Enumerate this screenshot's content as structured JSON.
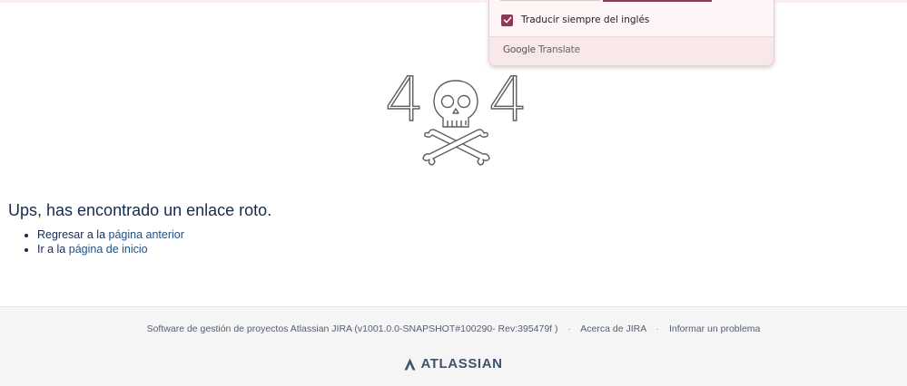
{
  "translate_popup": {
    "always_translate_label": "Traducir siempre del inglés",
    "always_translate_checked": true,
    "brand_google": "Google",
    "brand_translate": "Translate"
  },
  "error_page": {
    "digit_left": "4",
    "digit_right": "4",
    "message": "Ups, has encontrado un enlace roto.",
    "links": [
      {
        "prefix": "Regresar a la ",
        "link_text": "página anterior"
      },
      {
        "prefix": "Ir a la ",
        "link_text": "página de inicio"
      }
    ]
  },
  "footer": {
    "software_text": "Software de gestión de proyectos Atlassian JIRA (v1001.0.0-SNAPSHOT#100290- Rev:395479f )",
    "separator": "·",
    "about_link": "Acerca de JIRA",
    "report_link": "Informar un problema",
    "logo_text": "ATLASSIAN"
  },
  "colors": {
    "link": "#205081",
    "checkbox": "#8e3a55",
    "text": "#172b4d",
    "footer_bg": "#f5f5f5"
  },
  "icons": [
    "check-icon",
    "skull-crossbones-icon",
    "atlassian-logo-icon"
  ]
}
